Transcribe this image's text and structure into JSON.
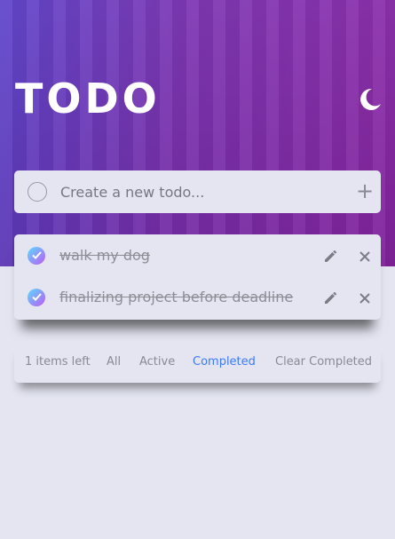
{
  "header": {
    "title": "TODO",
    "theme_icon": "moon-icon"
  },
  "create": {
    "placeholder": "Create a new todo...",
    "add_icon": "plus-icon"
  },
  "todos": [
    {
      "text": "walk my dog",
      "completed": true
    },
    {
      "text": "finalizing project before deadline",
      "completed": true
    }
  ],
  "footer": {
    "items_left": "1 items left",
    "filters": [
      "All",
      "Active",
      "Completed"
    ],
    "selected_filter": "Completed",
    "clear_label": "Clear Completed"
  },
  "colors": {
    "accent": "#3a7bfd",
    "check_gradient_start": "#57ddff",
    "check_gradient_end": "#c058f3",
    "background": "#e4e5f1",
    "hero_start": "#5a3fc9",
    "hero_end": "#8a25a6"
  }
}
